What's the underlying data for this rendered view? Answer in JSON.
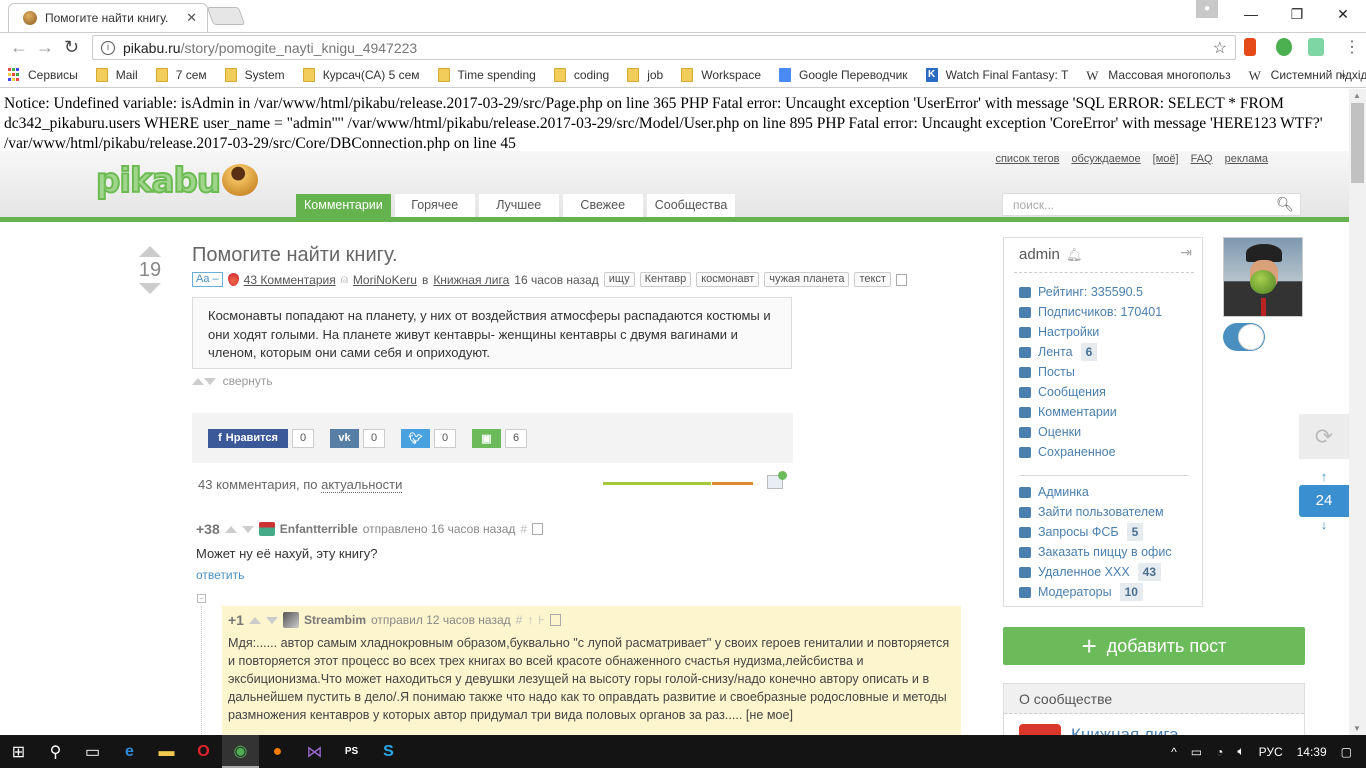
{
  "browser": {
    "tab_title": "Помогите найти книгу.",
    "url_host": "pikabu.ru",
    "url_path": "/story/pomogite_nayti_knigu_4947223",
    "bookmarks": [
      {
        "label": "Сервисы",
        "icon": "apps-icon"
      },
      {
        "label": "Mail",
        "icon": "folder-icon"
      },
      {
        "label": "7 сем",
        "icon": "folder-icon"
      },
      {
        "label": "System",
        "icon": "folder-icon"
      },
      {
        "label": "Курсач(СА) 5 сем",
        "icon": "folder-icon"
      },
      {
        "label": "Time spending",
        "icon": "folder-icon"
      },
      {
        "label": "coding",
        "icon": "folder-icon"
      },
      {
        "label": "job",
        "icon": "folder-icon"
      },
      {
        "label": "Workspace",
        "icon": "folder-icon"
      },
      {
        "label": "Google Переводчик",
        "icon": "google-translate-icon"
      },
      {
        "label": "Watch Final Fantasy: T",
        "icon": "k-icon"
      },
      {
        "label": "Массовая многопольз",
        "icon": "wikipedia-icon"
      },
      {
        "label": "Системний підхід — ",
        "icon": "wikipedia-icon"
      }
    ],
    "more": "»"
  },
  "php_error": "Notice: Undefined variable: isAdmin in /var/www/html/pikabu/release.2017-03-29/src/Page.php on line 365 PHP Fatal error: Uncaught exception 'UserError' with message 'SQL ERROR: SELECT * FROM dc342_pikaburu.users WHERE user_name = \"admin'\"' /var/www/html/pikabu/release.2017-03-29/src/Model/User.php on line 895 PHP Fatal error: Uncaught exception 'CoreError' with message 'HERE123 WTF?' /var/www/html/pikabu/release.2017-03-29/src/Core/DBConnection.php on line 45",
  "header": {
    "logo": "pikabu",
    "top_links": [
      "список тегов",
      "обсуждаемое",
      "[моё]",
      "FAQ",
      "реклама"
    ],
    "nav_tabs": [
      {
        "label": "Комментарии",
        "active": true
      },
      {
        "label": "Горячее",
        "active": false
      },
      {
        "label": "Лучшее",
        "active": false
      },
      {
        "label": "Свежее",
        "active": false
      },
      {
        "label": "Сообщества",
        "active": false
      }
    ],
    "search_placeholder": "поиск..."
  },
  "story": {
    "rating": "19",
    "title": "Помогите найти книгу.",
    "font_toggle": "Aa –",
    "comments_link": "43 Комментария",
    "author": "MoriNoKeru",
    "in_word": "в",
    "community": "Книжная лига",
    "time": "16 часов назад",
    "tags": [
      "ищу",
      "Кентавр",
      "космонавт",
      "чужая планета",
      "текст"
    ],
    "body": "Космонавты попадают на планету, у них от воздействия атмосферы распадаются костюмы и они ходят голыми. На планете живут кентавры- женщины кентавры с двумя вагинами и членом, которым они сами себя и оприходуют.",
    "collapse_label": "свернуть",
    "share": {
      "fb_label": "Нравится",
      "fb_count": "0",
      "vk_count": "0",
      "tw_count": "0",
      "save_count": "6"
    },
    "comments_summary_prefix": "43 комментария, по",
    "comments_sort": "актуальности",
    "rating_bar": {
      "positive_fraction": 0.72,
      "positive_color": "#a5c93c",
      "negative_color": "#e08a2e"
    }
  },
  "comments": [
    {
      "score": "+38",
      "user": "Enfantterrible",
      "action": "отправлено 16 часов назад",
      "hash": "#",
      "text": "Может ну её нахуй, эту книгу?",
      "reply_label": "ответить"
    },
    {
      "score": "+1",
      "user": "Streambim",
      "action": "отправил 12 часов назад",
      "hash": "#",
      "text": "Мдя:...... автор самым хладнокровным образом,буквально \"с лупой расматривает\" у своих героев гениталии и повторяется и повторяется этот процесс во всех трех книгах во всей красоте обнаженного счастья нудизма,лейсбиства и эксбиционизма.Что может находиться у девушки лезущей на высоту горы голой-снизу/надо конечно автору описать и в дальнейшем пустить в дело/.Я понимаю также что надо как то оправдать развитие и своебразные родословные и методы размножения кентавров у которых автор придумал три вида половых органов за раз..... [не мое]"
    }
  ],
  "sidebar": {
    "username": "admin",
    "stats": [
      {
        "label": "Рейтинг: 335590.5",
        "icon": "rating-bars-icon"
      },
      {
        "label": "Подписчиков: 170401",
        "icon": "user-icon"
      }
    ],
    "menu": [
      {
        "label": "Настройки",
        "icon": "gear-icon"
      },
      {
        "label": "Лента",
        "icon": "feed-icon",
        "badge": "6"
      },
      {
        "label": "Посты",
        "icon": "posts-icon"
      },
      {
        "label": "Сообщения",
        "icon": "mail-icon"
      },
      {
        "label": "Комментарии",
        "icon": "comment-icon"
      },
      {
        "label": "Оценки",
        "icon": "triangle-up-icon"
      },
      {
        "label": "Сохраненное",
        "icon": "save-icon"
      }
    ],
    "admin_menu": [
      {
        "label": "Админка",
        "icon": "shield-icon"
      },
      {
        "label": "Зайти пользователем",
        "icon": "users-icon"
      },
      {
        "label": "Запросы ФСБ",
        "icon": "shield-question-icon",
        "badge": "5"
      },
      {
        "label": "Заказать пиццу в офис",
        "icon": "pie-icon"
      },
      {
        "label": "Удаленное XXX",
        "icon": "smile-icon",
        "badge": "43"
      },
      {
        "label": "Модераторы",
        "icon": "shield-icon",
        "badge": "10"
      }
    ],
    "toggle_on": true,
    "page_number": "24",
    "add_post_label": "добавить пост",
    "about_title": "О сообществе",
    "community_name": "Книжная лига"
  },
  "taskbar": {
    "apps": [
      "windows-start-icon",
      "search-icon",
      "task-view-icon",
      "edge-icon",
      "file-explorer-icon",
      "opera-icon",
      "chrome-icon",
      "firefox-icon",
      "visual-studio-icon",
      "phpstorm-icon",
      "skype-icon"
    ],
    "language": "РУС",
    "time": "14:39"
  }
}
